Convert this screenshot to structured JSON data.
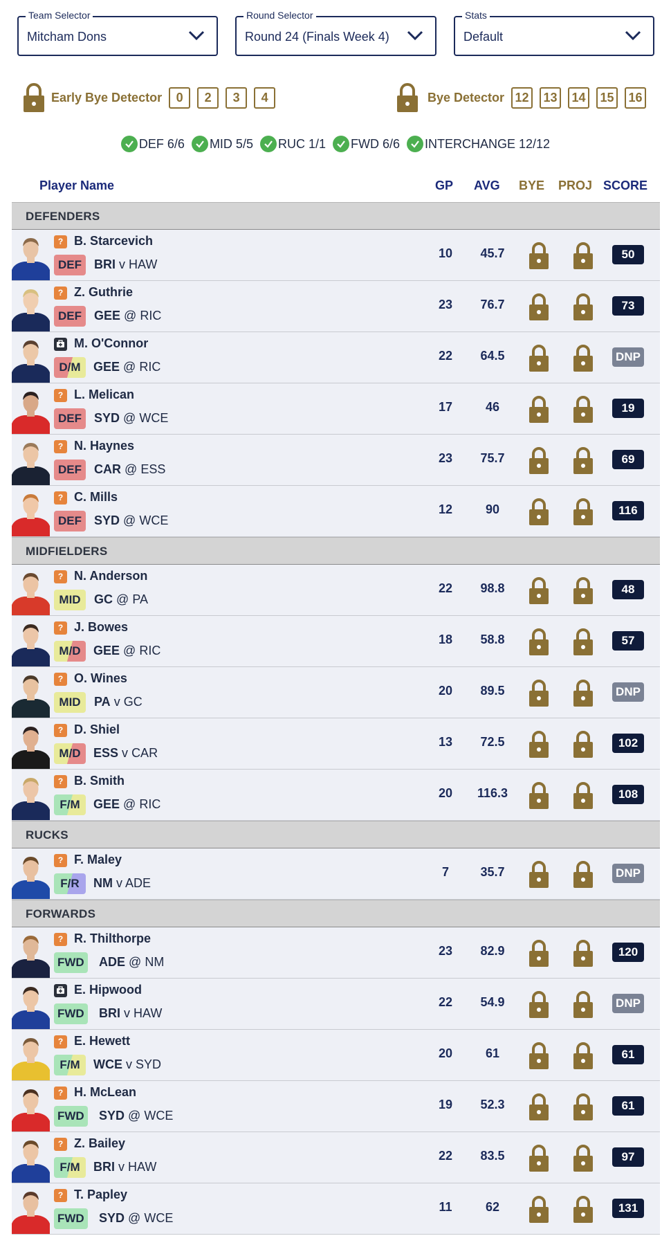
{
  "selectors": {
    "team": {
      "label": "Team Selector",
      "value": "Mitcham Dons"
    },
    "round": {
      "label": "Round Selector",
      "value": "Round 24 (Finals Week 4)"
    },
    "stats": {
      "label": "Stats",
      "value": "Default"
    }
  },
  "early_bye": {
    "title": "Early Bye Detector",
    "rounds": [
      "0",
      "2",
      "3",
      "4"
    ]
  },
  "bye": {
    "title": "Bye Detector",
    "rounds": [
      "12",
      "13",
      "14",
      "15",
      "16"
    ]
  },
  "summary": [
    "DEF 6/6",
    "MID 5/5",
    "RUC 1/1",
    "FWD 6/6",
    "INTERCHANGE 12/12"
  ],
  "columns": {
    "name": "Player Name",
    "gp": "GP",
    "avg": "AVG",
    "bye": "BYE",
    "proj": "PROJ",
    "score": "SCORE"
  },
  "colors": {
    "def": "#e58a8a",
    "mid": "#e8ea9a",
    "ruc": "#a9a5ec",
    "fwd": "#a9e4b8",
    "gold": "#8a7035",
    "navy": "#1b2a5a"
  },
  "sections": [
    {
      "title": "DEFENDERS",
      "players": [
        {
          "name": "B. Starcevich",
          "status": "?",
          "pos": "DEF",
          "team": "BRI",
          "sep": "v",
          "opp": "HAW",
          "gp": "10",
          "avg": "45.7",
          "score": "50",
          "jersey": "#1f3f9a",
          "skin": "#e8c4a6",
          "hair": "#8b6a4a"
        },
        {
          "name": "Z. Guthrie",
          "status": "?",
          "pos": "DEF",
          "team": "GEE",
          "sep": "@",
          "opp": "RIC",
          "gp": "23",
          "avg": "76.7",
          "score": "73",
          "jersey": "#1a2a5a",
          "skin": "#f0ceb0",
          "hair": "#d8c080"
        },
        {
          "name": "M. O'Connor",
          "status": "inj",
          "pos": "D/M",
          "team": "GEE",
          "sep": "@",
          "opp": "RIC",
          "gp": "22",
          "avg": "64.5",
          "score": "DNP",
          "jersey": "#1a2a5a",
          "skin": "#ecc8a8",
          "hair": "#5a4030"
        },
        {
          "name": "L. Melican",
          "status": "?",
          "pos": "DEF",
          "team": "SYD",
          "sep": "@",
          "opp": "WCE",
          "gp": "17",
          "avg": "46",
          "score": "19",
          "jersey": "#d92a2a",
          "skin": "#d8a888",
          "hair": "#2a2020"
        },
        {
          "name": "N. Haynes",
          "status": "?",
          "pos": "DEF",
          "team": "CAR",
          "sep": "@",
          "opp": "ESS",
          "gp": "23",
          "avg": "75.7",
          "score": "69",
          "jersey": "#1a2233",
          "skin": "#ecc6a6",
          "hair": "#9a7a5a"
        },
        {
          "name": "C. Mills",
          "status": "?",
          "pos": "DEF",
          "team": "SYD",
          "sep": "@",
          "opp": "WCE",
          "gp": "12",
          "avg": "90",
          "score": "116",
          "jersey": "#d92a2a",
          "skin": "#f0c8a8",
          "hair": "#c87a3a"
        }
      ]
    },
    {
      "title": "MIDFIELDERS",
      "players": [
        {
          "name": "N. Anderson",
          "status": "?",
          "pos": "MID",
          "team": "GC",
          "sep": "@",
          "opp": "PA",
          "gp": "22",
          "avg": "98.8",
          "score": "48",
          "jersey": "#d83a2a",
          "skin": "#ecc4a4",
          "hair": "#6a4a30"
        },
        {
          "name": "J. Bowes",
          "status": "?",
          "pos": "M/D",
          "team": "GEE",
          "sep": "@",
          "opp": "RIC",
          "gp": "18",
          "avg": "58.8",
          "score": "57",
          "jersey": "#1a2a5a",
          "skin": "#ecc6a8",
          "hair": "#3a2a20"
        },
        {
          "name": "O. Wines",
          "status": "?",
          "pos": "MID",
          "team": "PA",
          "sep": "v",
          "opp": "GC",
          "gp": "20",
          "avg": "89.5",
          "score": "DNP",
          "jersey": "#1a2a33",
          "skin": "#e8c2a0",
          "hair": "#4a3a2a"
        },
        {
          "name": "D. Shiel",
          "status": "?",
          "pos": "M/D",
          "team": "ESS",
          "sep": "v",
          "opp": "CAR",
          "gp": "13",
          "avg": "72.5",
          "score": "102",
          "jersey": "#1a1a1a",
          "skin": "#e0b090",
          "hair": "#2a2020"
        },
        {
          "name": "B. Smith",
          "status": "?",
          "pos": "F/M",
          "team": "GEE",
          "sep": "@",
          "opp": "RIC",
          "gp": "20",
          "avg": "116.3",
          "score": "108",
          "jersey": "#1a2a5a",
          "skin": "#ecc6a8",
          "hair": "#c8a868"
        }
      ]
    },
    {
      "title": "RUCKS",
      "players": [
        {
          "name": "F. Maley",
          "status": "?",
          "pos": "F/R",
          "team": "NM",
          "sep": "v",
          "opp": "ADE",
          "gp": "7",
          "avg": "35.7",
          "score": "DNP",
          "jersey": "#1f4aa8",
          "skin": "#e8c0a0",
          "hair": "#6a4a2a"
        }
      ]
    },
    {
      "title": "FORWARDS",
      "players": [
        {
          "name": "R. Thilthorpe",
          "status": "?",
          "pos": "FWD",
          "team": "ADE",
          "sep": "@",
          "opp": "NM",
          "gp": "23",
          "avg": "82.9",
          "score": "120",
          "jersey": "#1a2240",
          "skin": "#e0b898",
          "hair": "#9a6a3a"
        },
        {
          "name": "E. Hipwood",
          "status": "inj",
          "pos": "FWD",
          "team": "BRI",
          "sep": "v",
          "opp": "HAW",
          "gp": "22",
          "avg": "54.9",
          "score": "DNP",
          "jersey": "#1f3f9a",
          "skin": "#ecc6a6",
          "hair": "#3a2a20"
        },
        {
          "name": "E. Hewett",
          "status": "?",
          "pos": "F/M",
          "team": "WCE",
          "sep": "v",
          "opp": "SYD",
          "gp": "20",
          "avg": "61",
          "score": "61",
          "jersey": "#e8c030",
          "skin": "#ecc6a6",
          "hair": "#7a5a3a"
        },
        {
          "name": "H. McLean",
          "status": "?",
          "pos": "FWD",
          "team": "SYD",
          "sep": "@",
          "opp": "WCE",
          "gp": "19",
          "avg": "52.3",
          "score": "61",
          "jersey": "#d92a2a",
          "skin": "#ecc6a6",
          "hair": "#4a3020"
        },
        {
          "name": "Z. Bailey",
          "status": "?",
          "pos": "F/M",
          "team": "BRI",
          "sep": "v",
          "opp": "HAW",
          "gp": "22",
          "avg": "83.5",
          "score": "97",
          "jersey": "#1f3f9a",
          "skin": "#ecc6a6",
          "hair": "#6a4a2a"
        },
        {
          "name": "T. Papley",
          "status": "?",
          "pos": "FWD",
          "team": "SYD",
          "sep": "@",
          "opp": "WCE",
          "gp": "11",
          "avg": "62",
          "score": "131",
          "jersey": "#d92a2a",
          "skin": "#e8c0a0",
          "hair": "#5a3a2a"
        }
      ]
    }
  ]
}
